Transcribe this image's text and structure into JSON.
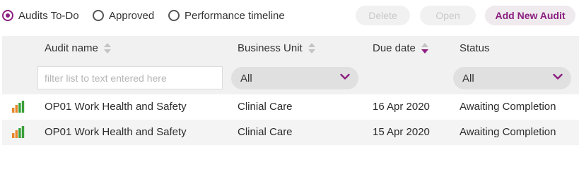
{
  "views": {
    "todo_label": "Audits To-Do",
    "approved_label": "Approved",
    "timeline_label": "Performance timeline",
    "selected": "todo"
  },
  "actions": {
    "delete_label": "Delete",
    "open_label": "Open",
    "add_label": "Add New Audit"
  },
  "table": {
    "columns": {
      "name": "Audit name",
      "business_unit": "Business Unit",
      "due_date": "Due date",
      "status": "Status"
    },
    "filters": {
      "name_placeholder": "filter list to text entered here",
      "business_unit_value": "All",
      "status_value": "All"
    },
    "rows": [
      {
        "name": "OP01 Work Health and Safety",
        "business_unit": "Clinial Care",
        "due_date": "16 Apr 2020",
        "status": "Awaiting Completion"
      },
      {
        "name": "OP01 Work Health and Safety",
        "business_unit": "Clinial Care",
        "due_date": "15 Apr 2020",
        "status": "Awaiting Completion"
      }
    ]
  },
  "colors": {
    "accent": "#8b1f7f",
    "chart_icon": [
      "#e8862a",
      "#e8862a",
      "#3aa03a",
      "#3aa03a"
    ]
  }
}
